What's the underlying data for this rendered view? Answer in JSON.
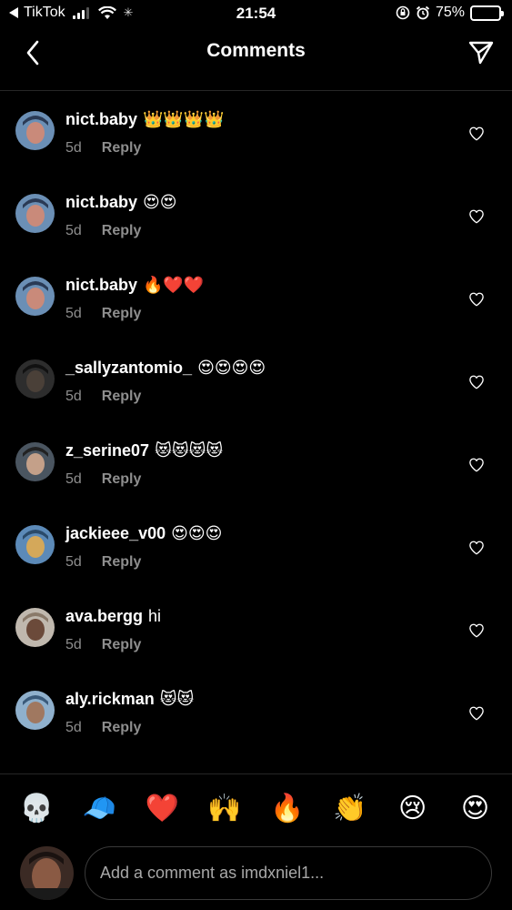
{
  "status_bar": {
    "back_app": "TikTok",
    "time": "21:54",
    "battery": "75%",
    "battery_level": 0.75,
    "icons": [
      "back-triangle-icon",
      "signal-icon",
      "wifi-icon",
      "loading-icon",
      "orientation-lock-icon",
      "alarm-icon",
      "battery-icon"
    ]
  },
  "header": {
    "title": "Comments",
    "back_icon": "chevron-left-icon",
    "send_icon": "paper-plane-icon"
  },
  "comments": [
    {
      "username": "nict.baby",
      "text": "👑👑👑👑",
      "age": "5d",
      "reply_label": "Reply"
    },
    {
      "username": "nict.baby",
      "text": "😍😍",
      "age": "5d",
      "reply_label": "Reply"
    },
    {
      "username": "nict.baby",
      "text": "🔥❤️❤️",
      "age": "5d",
      "reply_label": "Reply"
    },
    {
      "username": "_sallyzantomio_",
      "text": "😍😍😍😍",
      "age": "5d",
      "reply_label": "Reply"
    },
    {
      "username": "z_serine07",
      "text": "😻😻😻😻",
      "age": "5d",
      "reply_label": "Reply"
    },
    {
      "username": "jackieee_v00",
      "text": "😍😍😍",
      "age": "5d",
      "reply_label": "Reply"
    },
    {
      "username": "ava.bergg",
      "text": "hi",
      "age": "5d",
      "reply_label": "Reply"
    },
    {
      "username": "aly.rickman",
      "text": "😻😻",
      "age": "5d",
      "reply_label": "Reply"
    }
  ],
  "emoji_bar": [
    "💀",
    "🧢",
    "❤️",
    "🙌",
    "🔥",
    "👏",
    "😢",
    "😍"
  ],
  "composer": {
    "placeholder": "Add a comment as imdxniel1..."
  },
  "colors": {
    "background": "#000000",
    "secondary_text": "#8e8e8e",
    "battery_fill": "#32d74b"
  }
}
